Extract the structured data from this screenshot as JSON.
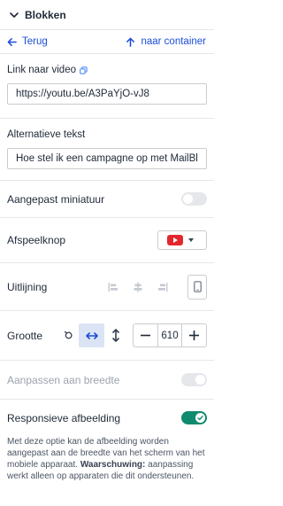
{
  "header": {
    "title": "Blokken"
  },
  "nav": {
    "back_label": "Terug",
    "container_label": "naar container"
  },
  "video": {
    "label": "Link naar video",
    "value": "https://youtu.be/A3PaYjO-vJ8"
  },
  "alt_text": {
    "label": "Alternatieve tekst",
    "value": "Hoe stel ik een campagne op met MailBl"
  },
  "custom_thumbnail": {
    "label": "Aangepast miniatuur",
    "enabled": false
  },
  "play_button": {
    "label": "Afspeelknop",
    "selected": "youtube-icon"
  },
  "alignment": {
    "label": "Uitlijning",
    "options": [
      "align-left-icon",
      "align-center-icon",
      "align-right-icon"
    ]
  },
  "size": {
    "label": "Grootte",
    "value": "610",
    "mode": "width"
  },
  "fit_width": {
    "label": "Aanpassen aan breedte",
    "enabled": true,
    "disabled": true
  },
  "responsive": {
    "label": "Responsieve afbeelding",
    "enabled": true,
    "description": "Met deze optie kan de afbeelding worden aangepast aan de breedte van het scherm van het mobiele apparaat.",
    "warning_label": "Waarschuwing:",
    "warning_text": "aanpassing werkt alleen op apparaten die dit ondersteunen."
  },
  "colors": {
    "accent": "#1d4ed8",
    "toggle_on": "#0f8a6e",
    "youtube_red": "#e4262d",
    "selected_bg": "#dbe4f5"
  }
}
